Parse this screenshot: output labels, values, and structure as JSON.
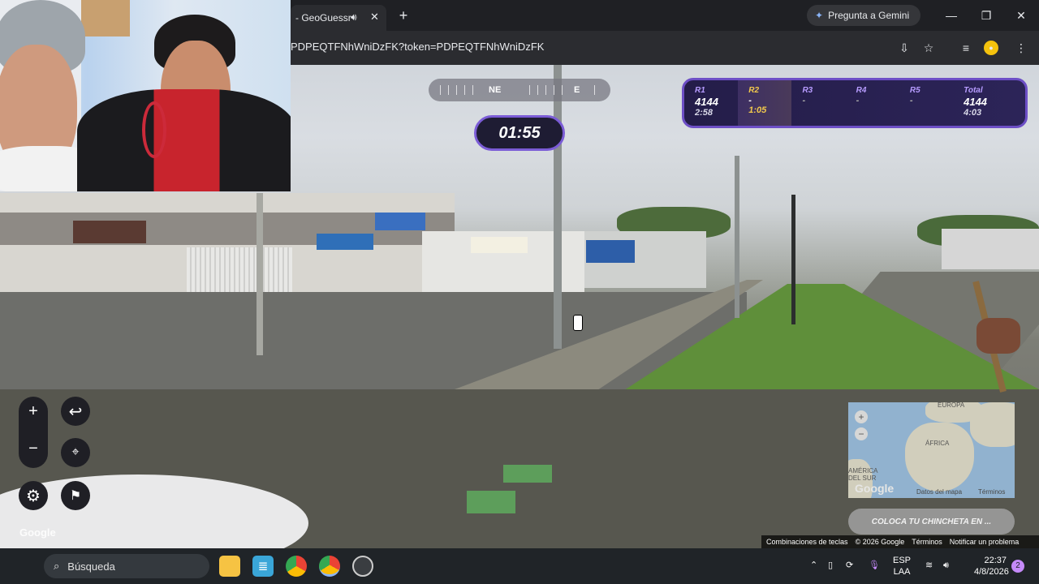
{
  "browser": {
    "tab_title": "- GeoGuessr",
    "url": "PDPEQTFNhWniDzFK?token=PDPEQTFNhWniDzFK",
    "gemini_label": "Pregunta a Gemini"
  },
  "game": {
    "compass": {
      "ne": "NE",
      "e": "E"
    },
    "timer": "01:55",
    "rounds": [
      {
        "label": "R1",
        "points": "4144",
        "time": "2:58"
      },
      {
        "label": "R2",
        "points": "-",
        "time": "1:05"
      },
      {
        "label": "R3",
        "points": "-",
        "time": ""
      },
      {
        "label": "R4",
        "points": "-",
        "time": ""
      },
      {
        "label": "R5",
        "points": "-",
        "time": ""
      }
    ],
    "total": {
      "label": "Total",
      "points": "4144",
      "time": "4:03"
    },
    "guess_button": "COLOCA TU CHINCHETA EN ...",
    "minimap": {
      "europa": "EUROPA",
      "africa": "ÁFRICA",
      "america": "AMÉRICA DEL SUR",
      "data": "Datos del mapa",
      "terms": "Términos",
      "google": "Google"
    },
    "google_logo": "Google"
  },
  "footer": {
    "shortcuts": "Combinaciones de teclas",
    "copyright": "© 2026 Google",
    "terms": "Términos",
    "report": "Notificar un problema"
  },
  "taskbar": {
    "search_placeholder": "Búsqueda",
    "lang_top": "ESP",
    "lang_bottom": "LAA",
    "time": "22:37",
    "date": "4/8/2026",
    "notification_count": "2"
  }
}
